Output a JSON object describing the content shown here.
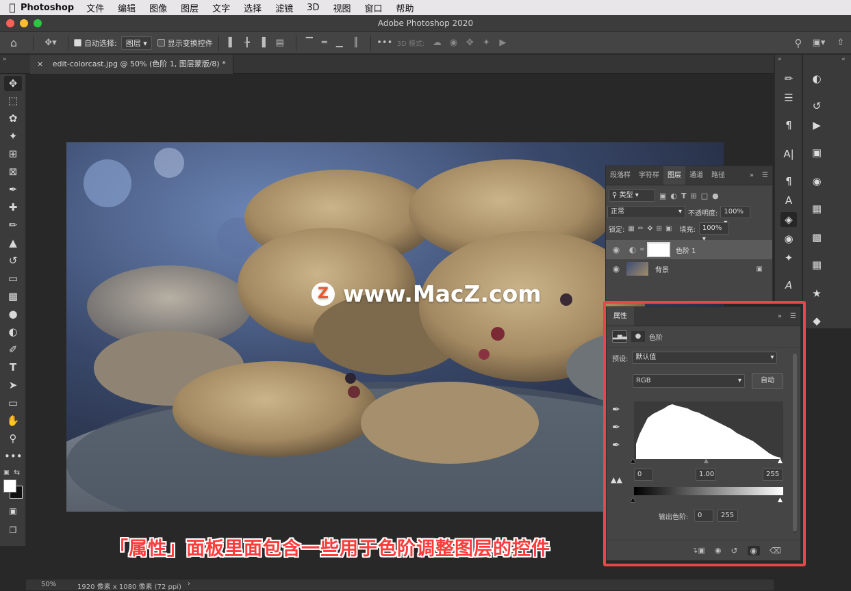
{
  "menubar": {
    "apple": "",
    "app": "Photoshop",
    "items": [
      "文件",
      "编辑",
      "图像",
      "图层",
      "文字",
      "选择",
      "滤镜",
      "3D",
      "视图",
      "窗口",
      "帮助"
    ]
  },
  "window": {
    "title": "Adobe Photoshop 2020"
  },
  "options": {
    "auto_select_label": "自动选择:",
    "auto_select_value": "图层",
    "show_transform_label": "显示变换控件",
    "mode_3d_label": "3D 模式:"
  },
  "document": {
    "tab_title": "edit-colorcast.jpg @ 50% (色阶 1, 图层蒙版/8) *",
    "zoom": "50%",
    "info": "1920 像素 x 1080 像素 (72 ppi)"
  },
  "layers_panel": {
    "tabs": [
      "段落样",
      "字符样",
      "图层",
      "通道",
      "路径"
    ],
    "active_tab": "图层",
    "filter_value": "类型",
    "blend_mode": "正常",
    "opacity_label": "不透明度:",
    "opacity_value": "100%",
    "lock_label": "锁定:",
    "fill_label": "填充:",
    "fill_value": "100%",
    "layers": [
      {
        "name": "色阶 1",
        "selected": true
      },
      {
        "name": "背景",
        "selected": false
      }
    ]
  },
  "properties_panel": {
    "tab": "属性",
    "adjustment_name": "色阶",
    "preset_label": "预设:",
    "preset_value": "默认值",
    "channel_value": "RGB",
    "auto_button": "自动",
    "input_black": "0",
    "input_gamma": "1.00",
    "input_white": "255",
    "output_label": "输出色阶:",
    "output_black": "0",
    "output_white": "255"
  },
  "overlay": {
    "watermark": "www.MacZ.com",
    "watermark_logo": "Z",
    "caption": "「属性」面板里面包含一些用于色阶调整图层的控件"
  },
  "colors": {
    "highlight_box": "#e5474b",
    "caption_text": "#ff3b3b"
  }
}
